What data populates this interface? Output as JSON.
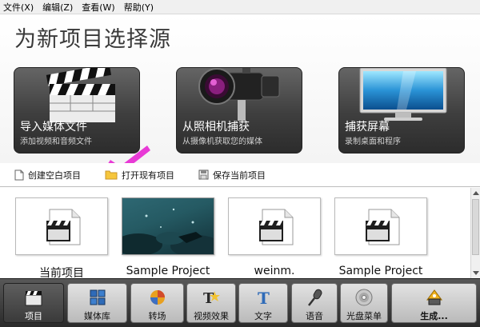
{
  "menu": [
    "文件(X)",
    "编辑(Z)",
    "查看(W)",
    "帮助(Y)"
  ],
  "page_title": "为新项目选择源",
  "sources": [
    {
      "label": "导入媒体文件",
      "sub": "添加视频和音频文件",
      "icon": "clapperboard-icon"
    },
    {
      "label": "从照相机捕获",
      "sub": "从摄像机获取您的媒体",
      "icon": "camcorder-icon"
    },
    {
      "label": "捕获屏幕",
      "sub": "录制桌面和程序",
      "icon": "monitor-icon"
    }
  ],
  "tools": [
    {
      "label": "创建空白项目",
      "icon": "blank-document-icon"
    },
    {
      "label": "打开现有项目",
      "icon": "folder-icon"
    },
    {
      "label": "保存当前项目",
      "icon": "save-icon"
    }
  ],
  "projects": [
    {
      "name": "当前项目",
      "thumb": "clapperboard-file-icon"
    },
    {
      "name": "Sample Project",
      "thumb": "underwater-photo"
    },
    {
      "name": "weinm.",
      "thumb": "clapperboard-file-icon"
    },
    {
      "name": "Sample Project",
      "thumb": "clapperboard-file-icon"
    }
  ],
  "nav": [
    {
      "label": "项目",
      "icon": "clapperboard-icon",
      "active": true
    },
    {
      "label": "媒体库",
      "icon": "media-library-icon"
    },
    {
      "label": "转场",
      "icon": "transition-icon"
    },
    {
      "label": "视频效果",
      "icon": "video-effects-icon"
    },
    {
      "label": "文字",
      "icon": "text-icon"
    },
    {
      "label": "语音",
      "icon": "microphone-icon"
    },
    {
      "label": "光盘菜单",
      "icon": "disc-icon"
    },
    {
      "label": "生成...",
      "icon": "produce-icon"
    }
  ],
  "colors": {
    "checkmark": "#e83ad6",
    "nav_active": "#4a4a4a",
    "panel": "#3e3e3e"
  }
}
